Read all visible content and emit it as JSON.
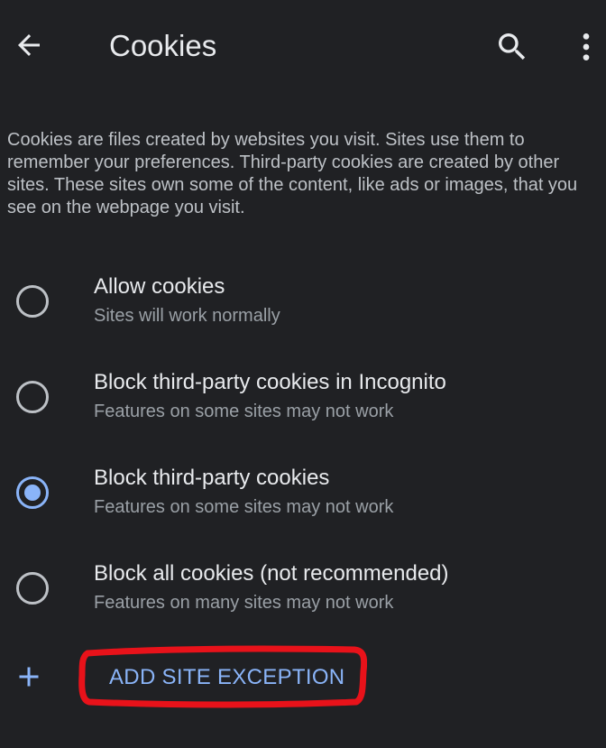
{
  "toolbar": {
    "title": "Cookies",
    "back_icon": "arrow-back-icon",
    "search_icon": "search-icon",
    "more_icon": "more-vertical-icon"
  },
  "description": "Cookies are files created by websites you visit. Sites use them to remember your preferences. Third-party cookies are created by other sites. These sites own some of the content, like ads or images, that you see on the webpage you visit.",
  "options": [
    {
      "title": "Allow cookies",
      "subtitle": "Sites will work normally",
      "selected": false
    },
    {
      "title": "Block third-party cookies in Incognito",
      "subtitle": "Features on some sites may not work",
      "selected": false
    },
    {
      "title": "Block third-party cookies",
      "subtitle": "Features on some sites may not work",
      "selected": true
    },
    {
      "title": "Block all cookies (not recommended)",
      "subtitle": "Features on many sites may not work",
      "selected": false
    }
  ],
  "add_exception": {
    "label": "ADD SITE EXCEPTION",
    "icon": "plus-icon"
  },
  "colors": {
    "background": "#202124",
    "accent": "#8ab4f8",
    "annotation": "#e8121a"
  }
}
